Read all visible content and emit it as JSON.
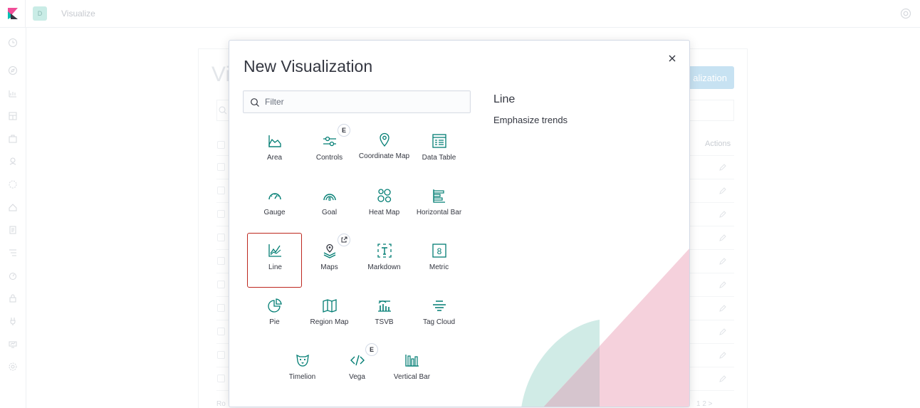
{
  "header": {
    "space_initial": "D",
    "breadcrumb": "Visualize"
  },
  "background": {
    "title": "Vi",
    "create_button": "alization",
    "actions_header": "Actions",
    "footer_left": "Ro",
    "pagination": "1   2   >"
  },
  "modal": {
    "title": "New Visualization",
    "filter_placeholder": "Filter",
    "description": {
      "title": "Line",
      "text": "Emphasize trends"
    },
    "tiles": [
      {
        "label": "Area",
        "icon": "area-chart-icon"
      },
      {
        "label": "Controls",
        "icon": "controls-icon",
        "badge": "E"
      },
      {
        "label": "Coordinate Map",
        "icon": "map-pin-icon"
      },
      {
        "label": "Data Table",
        "icon": "table-icon"
      },
      {
        "label": "Gauge",
        "icon": "gauge-icon"
      },
      {
        "label": "Goal",
        "icon": "goal-icon"
      },
      {
        "label": "Heat Map",
        "icon": "heatmap-icon"
      },
      {
        "label": "Horizontal Bar",
        "icon": "horizontal-bar-icon"
      },
      {
        "label": "Line",
        "icon": "line-chart-icon",
        "selected": true
      },
      {
        "label": "Maps",
        "icon": "maps-icon",
        "badge_icon": "external-link-icon"
      },
      {
        "label": "Markdown",
        "icon": "markdown-icon"
      },
      {
        "label": "Metric",
        "icon": "metric-icon"
      },
      {
        "label": "Pie",
        "icon": "pie-chart-icon"
      },
      {
        "label": "Region Map",
        "icon": "region-map-icon"
      },
      {
        "label": "TSVB",
        "icon": "tsvb-icon"
      },
      {
        "label": "Tag Cloud",
        "icon": "tag-cloud-icon"
      },
      {
        "label": "Timelion",
        "icon": "timelion-icon"
      },
      {
        "label": "Vega",
        "icon": "vega-icon",
        "badge": "E"
      },
      {
        "label": "Vertical Bar",
        "icon": "vertical-bar-icon"
      }
    ]
  },
  "colors": {
    "accent": "#017d73",
    "selected_border": "#bd271e",
    "decor_pink": "#f3c9d6",
    "decor_teal": "#c8e7e2"
  }
}
